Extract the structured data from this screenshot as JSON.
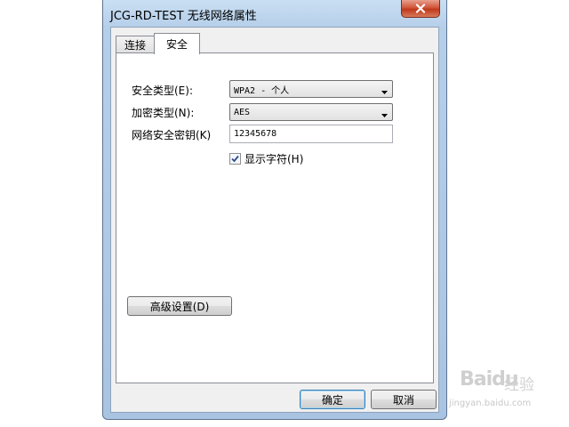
{
  "window": {
    "title": "JCG-RD-TEST 无线网络属性"
  },
  "tabs": [
    {
      "label": "连接",
      "active": false
    },
    {
      "label": "安全",
      "active": true
    }
  ],
  "security": {
    "security_type_label": "安全类型(E):",
    "security_type_value": "WPA2 - 个人",
    "encryption_type_label": "加密类型(N):",
    "encryption_type_value": "AES",
    "key_label": "网络安全密钥(K)",
    "key_value": "12345678",
    "show_chars_label": "显示字符(H)",
    "show_chars_checked": true
  },
  "buttons": {
    "advanced": "高级设置(D)",
    "ok": "确定",
    "cancel": "取消"
  },
  "icons": {
    "close": "close-icon",
    "dropdown": "chevron-down-icon",
    "check": "checkmark-icon"
  },
  "watermark": {
    "brand": "Baidu",
    "cn": "经验",
    "url": "jingyan.baidu.com"
  }
}
